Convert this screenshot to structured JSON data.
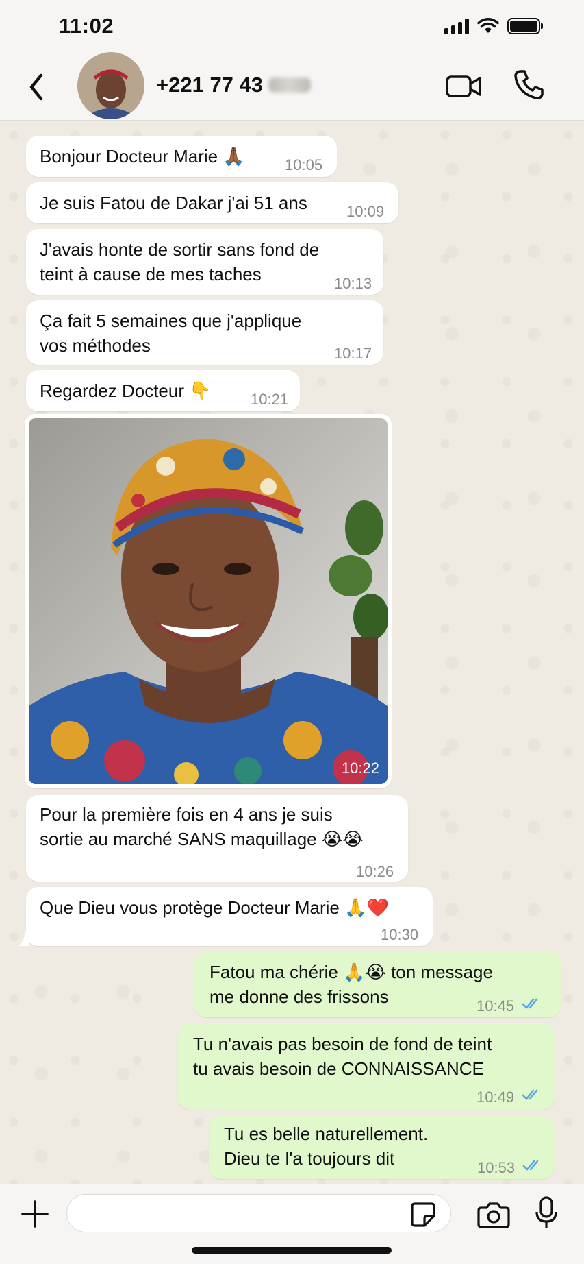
{
  "status_bar": {
    "time": "11:02"
  },
  "header": {
    "contact_name": "+221 77 43",
    "icons": [
      "back-icon",
      "video-call-icon",
      "phone-icon"
    ]
  },
  "messages": [
    {
      "text": "Bonjour Docteur Marie 🙏🏾",
      "time": "10:05",
      "direction": "in"
    },
    {
      "text": "Je suis Fatou de Dakar j'ai 51 ans",
      "time": "10:09",
      "direction": "in"
    },
    {
      "text": "J'avais honte de sortir sans fond de\nteint à cause de mes taches",
      "time": "10:13",
      "direction": "in"
    },
    {
      "text": "Ça fait 5 semaines que j'applique\nvos méthodes",
      "time": "10:17",
      "direction": "in"
    },
    {
      "text": "Regardez Docteur 👇",
      "time": "10:21",
      "direction": "in"
    },
    {
      "text": "",
      "time": "10:22",
      "direction": "in",
      "type": "photo"
    },
    {
      "text": "Pour la première fois en 4 ans je suis\nsortie au marché SANS maquillage 😭😭",
      "time": "10:26",
      "direction": "in"
    },
    {
      "text": "Que Dieu vous protège Docteur Marie 🙏❤️",
      "time": "10:30",
      "direction": "in"
    },
    {
      "text": "Fatou ma chérie 🙏😭  ton message\nme donne des frissons",
      "time": "10:45",
      "direction": "out"
    },
    {
      "text": "Tu n'avais pas besoin de fond de teint\ntu avais besoin de CONNAISSANCE",
      "time": "10:49",
      "direction": "out"
    },
    {
      "text": "Tu es belle naturellement.\nDieu te l'a toujours dit",
      "time": "10:53",
      "direction": "out"
    }
  ],
  "input": {
    "value": "",
    "placeholder": ""
  },
  "colors": {
    "incoming_bubble": "#ffffff",
    "outgoing_bubble": "#e0f8cc",
    "read_ticks": "#53a6e6",
    "chat_bg": "#efebe3"
  }
}
